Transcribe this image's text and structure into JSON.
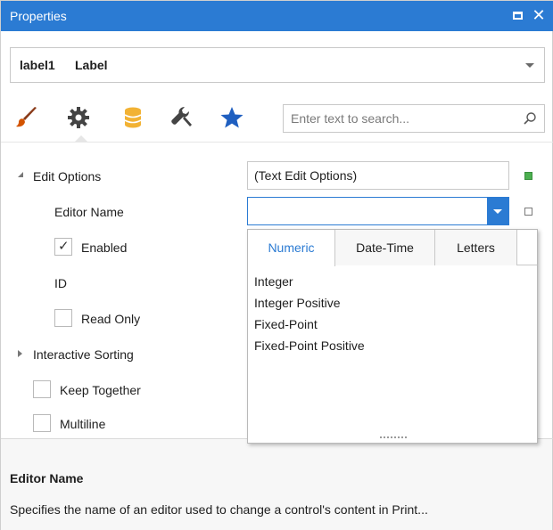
{
  "window": {
    "title": "Properties",
    "accent_color": "#2b7bd3",
    "buttons": [
      "maximize-icon",
      "close-icon"
    ]
  },
  "component_selector": {
    "name": "label1",
    "type": "Label"
  },
  "toolbar": {
    "tabs": [
      {
        "icon": "brush-icon",
        "color": "#d35400",
        "selected": false
      },
      {
        "icon": "gear-icon",
        "color": "#444444",
        "selected": true
      },
      {
        "icon": "database-icon",
        "color": "#f2b234",
        "selected": false
      },
      {
        "icon": "wrench-icon",
        "color": "#444444",
        "selected": false
      },
      {
        "icon": "star-icon",
        "color": "#1f5fc0",
        "selected": false
      }
    ],
    "search_placeholder": "Enter text to search..."
  },
  "properties": {
    "edit_options": {
      "label": "Edit Options",
      "value": "(Text Edit Options)",
      "expanded": true
    },
    "editor_name": {
      "label": "Editor Name",
      "value": ""
    },
    "enabled": {
      "label": "Enabled",
      "checked": true,
      "check_mark": "✓"
    },
    "id": {
      "label": "ID"
    },
    "read_only": {
      "label": "Read Only",
      "checked": false
    },
    "interactive_sorting": {
      "label": "Interactive Sorting",
      "expanded": false
    },
    "keep_together": {
      "label": "Keep Together",
      "checked": false
    },
    "multiline": {
      "label": "Multiline",
      "checked": false
    }
  },
  "editor_popup": {
    "tabs": [
      "Numeric",
      "Date-Time",
      "Letters"
    ],
    "active_tab": "Numeric",
    "items": [
      "Integer",
      "Integer Positive",
      "Fixed-Point",
      "Fixed-Point Positive"
    ]
  },
  "description": {
    "title": "Editor Name",
    "text": "Specifies the name of an editor used to change a control's content in Print..."
  }
}
